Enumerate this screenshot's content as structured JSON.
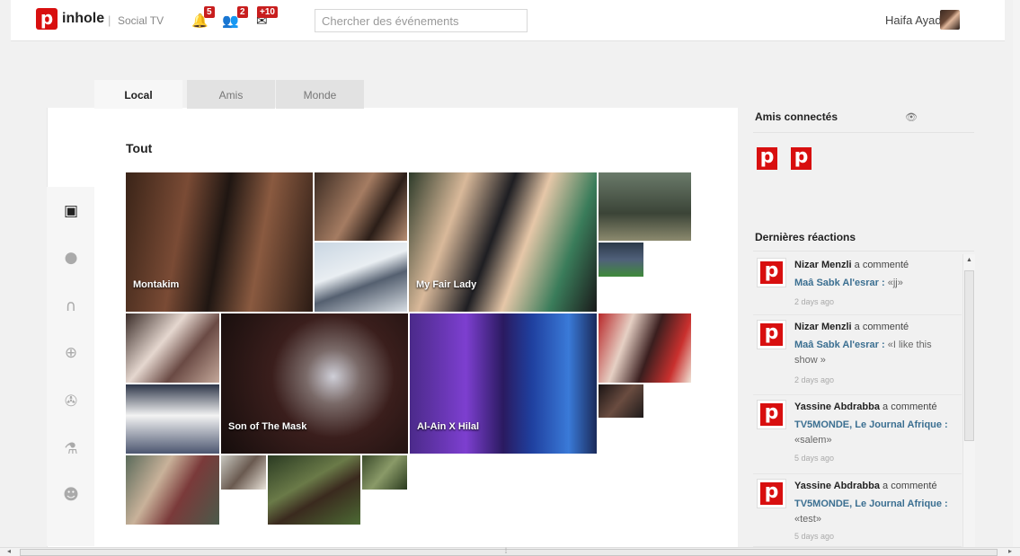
{
  "header": {
    "logo_letter": "p",
    "brand": "inhole",
    "separator": "|",
    "subtitle": "Social TV",
    "notifications": [
      {
        "icon": "bell-icon",
        "count": "5"
      },
      {
        "icon": "users-icon",
        "count": "2"
      },
      {
        "icon": "messages-icon",
        "count": "+10"
      }
    ],
    "search_placeholder": "Chercher des événements",
    "user_name": "Haifa Ayadi"
  },
  "tabs": [
    {
      "label": "Local",
      "active": true
    },
    {
      "label": "Amis",
      "active": false
    },
    {
      "label": "Monde",
      "active": false
    }
  ],
  "section_title": "Tout",
  "side_icons": [
    {
      "name": "tv-icon",
      "glyph": "📺",
      "active": true
    },
    {
      "name": "sport-ball-icon",
      "glyph": "⚾",
      "active": false
    },
    {
      "name": "headphones-icon",
      "glyph": "🎧",
      "active": false
    },
    {
      "name": "globe-icon",
      "glyph": "🌐",
      "active": false
    },
    {
      "name": "film-reel-icon",
      "glyph": "🎞",
      "active": false
    },
    {
      "name": "flask-icon",
      "glyph": "⚗",
      "active": false
    },
    {
      "name": "smiley-icon",
      "glyph": "☺",
      "active": false
    }
  ],
  "tiles": [
    {
      "caption": "Montakim"
    },
    {
      "caption": ""
    },
    {
      "caption": ""
    },
    {
      "caption": "My Fair Lady"
    },
    {
      "caption": ""
    },
    {
      "caption": ""
    },
    {
      "caption": ""
    },
    {
      "caption": "Son of The Mask"
    },
    {
      "caption": ""
    },
    {
      "caption": "Al-Ain X Hilal"
    },
    {
      "caption": ""
    },
    {
      "caption": ""
    },
    {
      "caption": ""
    },
    {
      "caption": ""
    },
    {
      "caption": ""
    },
    {
      "caption": ""
    }
  ],
  "right": {
    "friends_title": "Amis connectés",
    "friends_logo": "p",
    "reactions_title": "Dernières réactions",
    "reactions": [
      {
        "user": "Nizar Menzli",
        "action": "a commenté",
        "show": "Maâ Sabk Al'esrar :",
        "comment": "«jj»",
        "when": "2 days ago"
      },
      {
        "user": "Nizar Menzli",
        "action": "a commenté",
        "show": "Maâ Sabk Al'esrar :",
        "comment": "«I like this show »",
        "when": "2 days ago"
      },
      {
        "user": "Yassine Abdrabba",
        "action": "a commenté",
        "show": "TV5MONDE, Le Journal Afrique :",
        "comment": "«salem»",
        "when": "5 days ago"
      },
      {
        "user": "Yassine Abdrabba",
        "action": "a commenté",
        "show": "TV5MONDE, Le Journal Afrique :",
        "comment": "«test»",
        "when": "5 days ago"
      }
    ]
  },
  "colors": {
    "brand_red": "#d80f0f",
    "badge_red": "#c81e1e",
    "link_blue": "#3b6f91"
  }
}
